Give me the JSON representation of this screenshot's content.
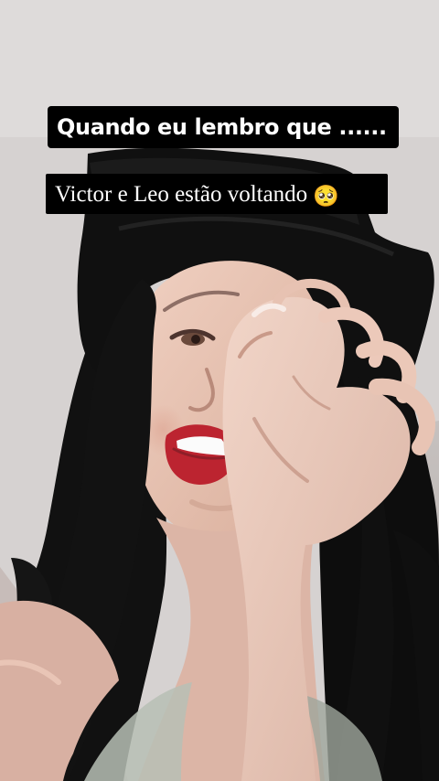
{
  "captions": {
    "top_text": "Quando eu lembro que ......",
    "bottom_text": "Victor e Leo estão voltando",
    "bottom_emoji": "🥺"
  },
  "scene": {
    "subject": "woman-in-black-hat",
    "background_color": "#d7d4d3",
    "hat_color": "#101010",
    "hair_color": "#111111",
    "lip_color": "#b61f2a",
    "skin_color": "#e9c5b4",
    "caption_bg_color": "#000000",
    "caption_text_color": "#ffffff"
  }
}
